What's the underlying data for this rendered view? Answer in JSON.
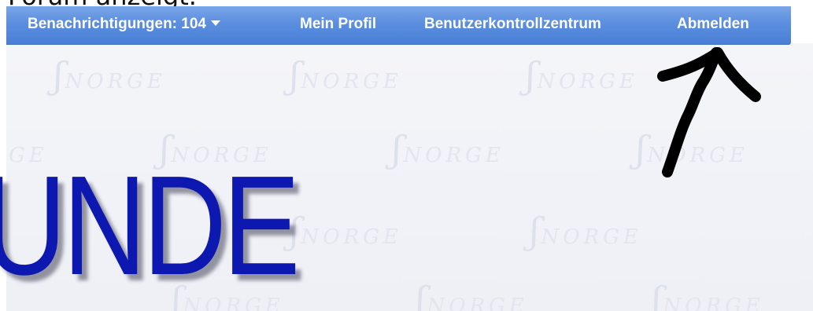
{
  "caption": {
    "text": "Forum anzeigt."
  },
  "navbar": {
    "notifications_label": "Benachrichtigungen: 104",
    "profile_label": "Mein Profil",
    "ucp_label": "Benutzerkontrollzentrum",
    "logout_label": "Abmelden",
    "icons": {
      "dropdown": "chevron-down-icon"
    }
  },
  "logo": {
    "text": "UNDE"
  },
  "watermark": {
    "text": "NORGE"
  },
  "colors": {
    "navbar": "#5b8ede",
    "logo": "#0c18b0",
    "background": "#f0f2f7",
    "annotation_arrow": "#000000"
  }
}
